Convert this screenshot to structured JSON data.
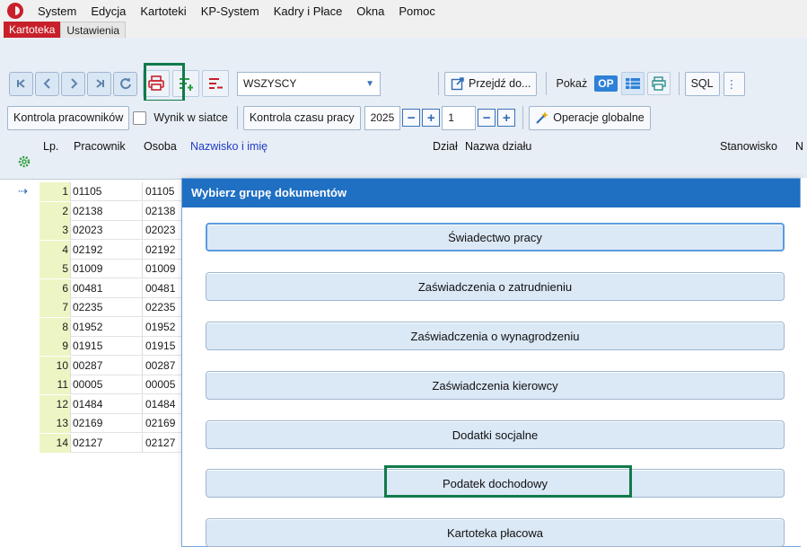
{
  "menu": [
    "System",
    "Edycja",
    "Kartoteki",
    "KP-System",
    "Kadry i Płace",
    "Okna",
    "Pomoc"
  ],
  "tabs": {
    "active": "Kartoteka",
    "inactive": "Ustawienia"
  },
  "toolbar1": {
    "nav_buttons": [
      "|<",
      "<",
      ">",
      ">|",
      "refresh"
    ],
    "filter_value": "WSZYSCY",
    "goto_label": "Przejdź do...",
    "show_label": "Pokaż",
    "op_badge": "OP",
    "sql_label": "SQL"
  },
  "toolbar2": {
    "control_employees": "Kontrola pracowników",
    "grid_result": "Wynik w siatce",
    "time_control": "Kontrola czasu pracy",
    "year": "2025",
    "month": "1",
    "global_ops": "Operacje globalne"
  },
  "grid": {
    "headers": {
      "lp": "Lp.",
      "employee": "Pracownik",
      "person": "Osoba",
      "name": "Nazwisko i imię",
      "dept": "Dział",
      "dept_name": "Nazwa działu",
      "position": "Stanowisko",
      "extra": "N"
    },
    "rows": [
      {
        "lp": "1",
        "employee": "01105",
        "person": "01105",
        "current": true
      },
      {
        "lp": "2",
        "employee": "02138",
        "person": "02138"
      },
      {
        "lp": "3",
        "employee": "02023",
        "person": "02023"
      },
      {
        "lp": "4",
        "employee": "02192",
        "person": "02192"
      },
      {
        "lp": "5",
        "employee": "01009",
        "person": "01009"
      },
      {
        "lp": "6",
        "employee": "00481",
        "person": "00481"
      },
      {
        "lp": "7",
        "employee": "02235",
        "person": "02235"
      },
      {
        "lp": "8",
        "employee": "01952",
        "person": "01952"
      },
      {
        "lp": "9",
        "employee": "01915",
        "person": "01915"
      },
      {
        "lp": "10",
        "employee": "00287",
        "person": "00287"
      },
      {
        "lp": "11",
        "employee": "00005",
        "person": "00005"
      },
      {
        "lp": "12",
        "employee": "01484",
        "person": "01484"
      },
      {
        "lp": "13",
        "employee": "02169",
        "person": "02169"
      },
      {
        "lp": "14",
        "employee": "02127",
        "person": "02127"
      }
    ]
  },
  "dialog": {
    "title": "Wybierz grupę dokumentów",
    "buttons": [
      "Świadectwo pracy",
      "Zaświadczenia o zatrudnieniu",
      "Zaświadczenia o wynagrodzeniu",
      "Zaświadczenia kierowcy",
      "Dodatki socjalne",
      "Podatek dochodowy",
      "Kartoteka płacowa"
    ]
  },
  "colors": {
    "accent": "#c8202a",
    "dialog_title": "#1f6fc2",
    "highlight": "#117a4b",
    "lp_col": "#edf5c4"
  }
}
